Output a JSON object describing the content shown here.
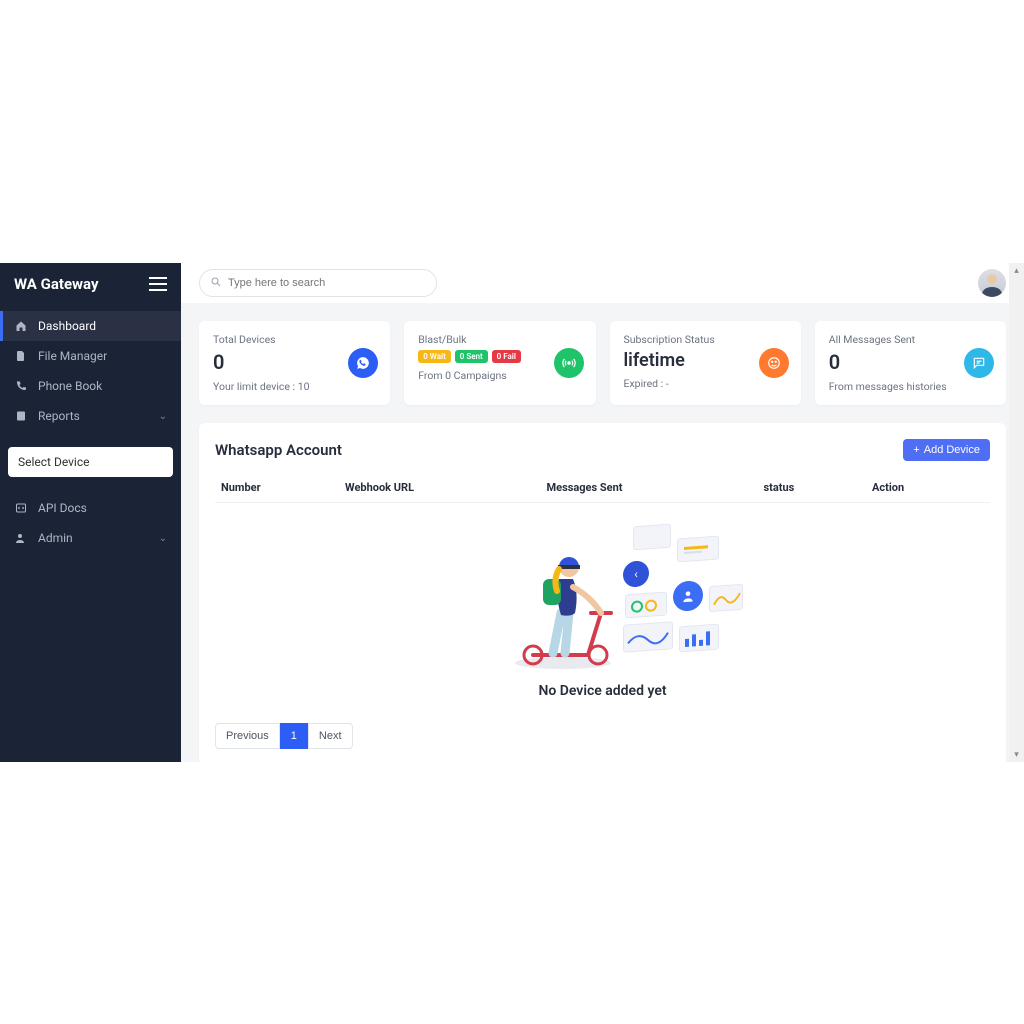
{
  "brand": "WA Gateway",
  "search": {
    "placeholder": "Type here to search"
  },
  "sidebar": {
    "items": [
      {
        "label": "Dashboard"
      },
      {
        "label": "File Manager"
      },
      {
        "label": "Phone Book"
      },
      {
        "label": "Reports"
      }
    ],
    "select_label": "Select Device",
    "items2": [
      {
        "label": "API Docs"
      },
      {
        "label": "Admin"
      }
    ]
  },
  "cards": {
    "devices": {
      "title": "Total Devices",
      "value": "0",
      "sub": "Your limit device : 10"
    },
    "blast": {
      "title": "Blast/Bulk",
      "wait": "0 Wait",
      "sent": "0 Sent",
      "fail": "0 Fail",
      "sub": "From 0 Campaigns"
    },
    "subscription": {
      "title": "Subscription Status",
      "value": "lifetime",
      "sub": "Expired : -"
    },
    "messages": {
      "title": "All Messages Sent",
      "value": "0",
      "sub": "From messages histories"
    }
  },
  "panel": {
    "title": "Whatsapp Account",
    "add_label": "Add Device",
    "columns": [
      "Number",
      "Webhook URL",
      "Messages Sent",
      "status",
      "Action"
    ],
    "empty": "No Device added yet"
  },
  "pagination": {
    "prev": "Previous",
    "page": "1",
    "next": "Next"
  }
}
